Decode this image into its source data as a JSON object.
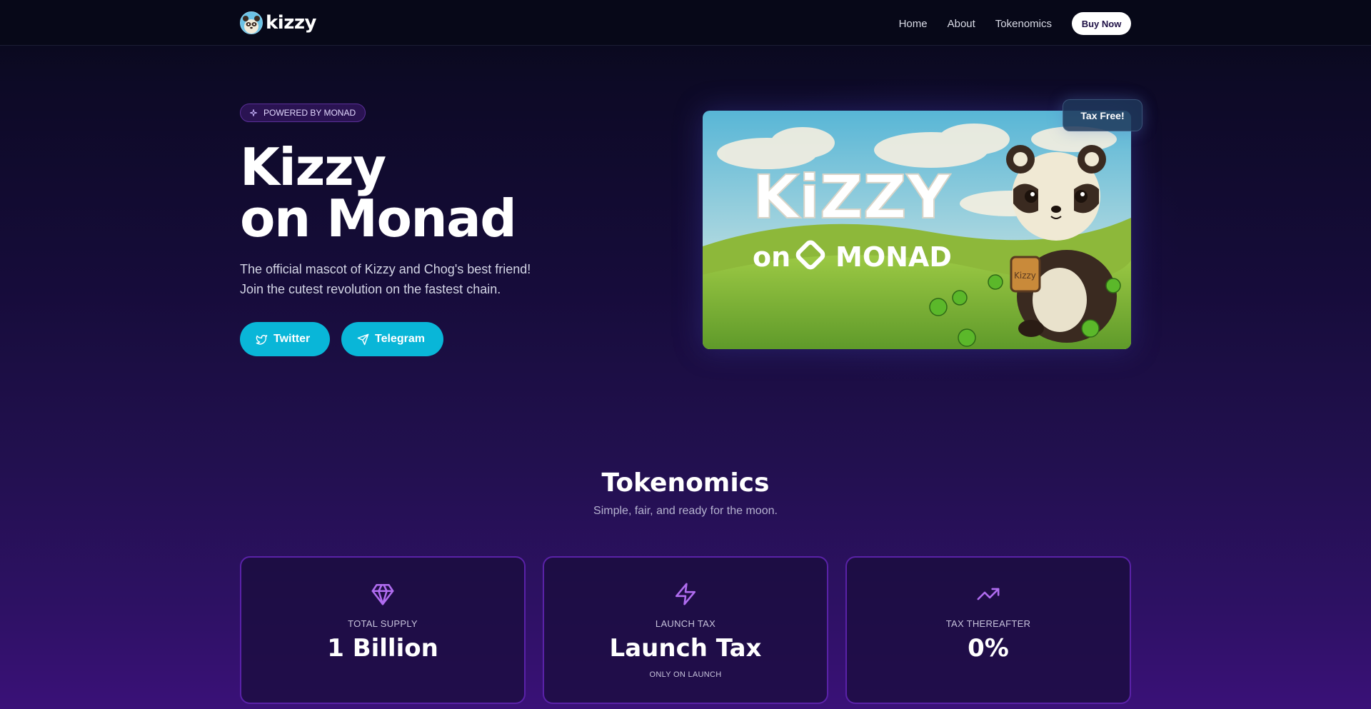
{
  "header": {
    "logo_text": "kizzy",
    "nav": [
      {
        "label": "Home"
      },
      {
        "label": "About"
      },
      {
        "label": "Tokenomics"
      }
    ],
    "buy_label": "Buy Now"
  },
  "hero": {
    "badge_label": "POWERED BY MONAD",
    "title_line1": "Kizzy",
    "title_line2": "on Monad",
    "subtitle_line1": "The official mascot of Kizzy and Chog's best friend!",
    "subtitle_line2": "Join the cutest revolution on the fastest chain.",
    "twitter_label": "Twitter",
    "telegram_label": "Telegram",
    "image_caption_brand": "KiZZY",
    "image_caption_on": "on",
    "image_caption_chain": "MONAD",
    "mug_text": "Kizzy",
    "tax_badge": "Tax Free!"
  },
  "tokenomics": {
    "title": "Tokenomics",
    "subtitle": "Simple, fair, and ready for the moon.",
    "cards": [
      {
        "icon": "gem-icon",
        "label": "TOTAL SUPPLY",
        "value": "1 Billion",
        "note": ""
      },
      {
        "icon": "bolt-icon",
        "label": "LAUNCH TAX",
        "value": "Launch Tax",
        "note": "ONLY ON LAUNCH"
      },
      {
        "icon": "trending-up-icon",
        "label": "TAX THEREAFTER",
        "value": "0%",
        "note": ""
      }
    ]
  },
  "colors": {
    "accent_cyan": "#09b6d8",
    "card_border": "#5a22a8",
    "icon_purple": "#b06cf0",
    "background_top": "#070818",
    "background_bottom": "#3a1178"
  }
}
